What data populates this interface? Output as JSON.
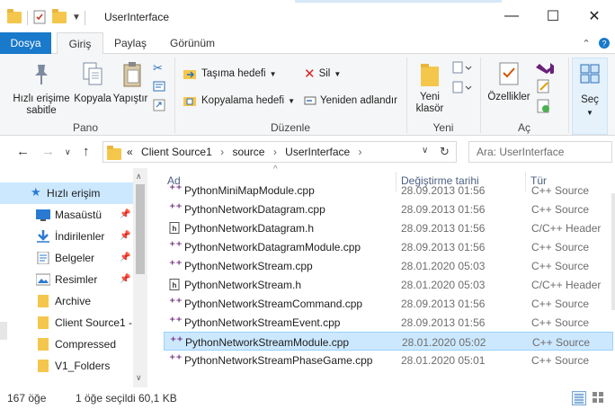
{
  "window": {
    "title": "UserInterface",
    "minimize": "—",
    "maximize": "☐",
    "close": "✕"
  },
  "tabs": {
    "file": "Dosya",
    "home": "Giriş",
    "share": "Paylaş",
    "view": "Görünüm"
  },
  "ribbon": {
    "pano": {
      "label": "Pano",
      "pin_quick": "Hızlı erişime sabitle",
      "copy": "Kopyala",
      "paste": "Yapıştır"
    },
    "duzenle": {
      "label": "Düzenle",
      "move_to": "Taşıma hedefi",
      "copy_to": "Kopyalama hedefi",
      "delete": "Sil",
      "rename": "Yeniden adlandır"
    },
    "yeni": {
      "label": "Yeni",
      "new_folder": "Yeni klasör"
    },
    "ac": {
      "label": "Aç",
      "properties": "Özellikler"
    },
    "sec": {
      "label": "Seç"
    }
  },
  "address": {
    "prefix": "«",
    "crumbs": [
      "Client Source1",
      "source",
      "UserInterface"
    ],
    "search_placeholder": "Ara: UserInterface"
  },
  "nav": {
    "items": [
      {
        "label": "Hızlı erişim",
        "icon": "star-icon",
        "pinned": false
      },
      {
        "label": "Masaüstü",
        "icon": "desktop-icon",
        "pinned": true
      },
      {
        "label": "İndirilenler",
        "icon": "download-icon",
        "pinned": true
      },
      {
        "label": "Belgeler",
        "icon": "documents-icon",
        "pinned": true
      },
      {
        "label": "Resimler",
        "icon": "pictures-icon",
        "pinned": true
      },
      {
        "label": "Archive",
        "icon": "folder-icon",
        "pinned": false
      },
      {
        "label": "Client Source1 -",
        "icon": "folder-icon",
        "pinned": false
      },
      {
        "label": "Compressed",
        "icon": "folder-icon",
        "pinned": false
      },
      {
        "label": "V1_Folders",
        "icon": "folder-icon",
        "pinned": false
      }
    ]
  },
  "columns": {
    "name": "Ad",
    "date": "Değiştirme tarihi",
    "type": "Tür"
  },
  "files": [
    {
      "name": "PythonMiniMapModule.cpp",
      "date": "28.09.2013 01:56",
      "type": "C++ Source",
      "kind": "cpp"
    },
    {
      "name": "PythonNetworkDatagram.cpp",
      "date": "28.09.2013 01:56",
      "type": "C++ Source",
      "kind": "cpp"
    },
    {
      "name": "PythonNetworkDatagram.h",
      "date": "28.09.2013 01:56",
      "type": "C/C++ Header",
      "kind": "h"
    },
    {
      "name": "PythonNetworkDatagramModule.cpp",
      "date": "28.09.2013 01:56",
      "type": "C++ Source",
      "kind": "cpp"
    },
    {
      "name": "PythonNetworkStream.cpp",
      "date": "28.01.2020 05:03",
      "type": "C++ Source",
      "kind": "cpp"
    },
    {
      "name": "PythonNetworkStream.h",
      "date": "28.01.2020 05:03",
      "type": "C/C++ Header",
      "kind": "h"
    },
    {
      "name": "PythonNetworkStreamCommand.cpp",
      "date": "28.09.2013 01:56",
      "type": "C++ Source",
      "kind": "cpp"
    },
    {
      "name": "PythonNetworkStreamEvent.cpp",
      "date": "28.09.2013 01:56",
      "type": "C++ Source",
      "kind": "cpp"
    },
    {
      "name": "PythonNetworkStreamModule.cpp",
      "date": "28.01.2020 05:02",
      "type": "C++ Source",
      "kind": "cpp",
      "selected": true
    },
    {
      "name": "PythonNetworkStreamPhaseGame.cpp",
      "date": "28.01.2020 05:01",
      "type": "C++ Source",
      "kind": "cpp"
    }
  ],
  "status": {
    "count": "167 öğe",
    "selection": "1 öğe seçildi",
    "size": "60,1 KB"
  },
  "colors": {
    "accent": "#1979ca",
    "selection": "#cce8ff",
    "cpp_icon": "#68217a"
  }
}
